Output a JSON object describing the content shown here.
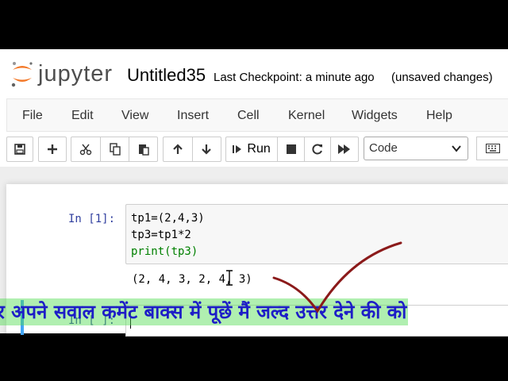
{
  "header": {
    "logo_text": "jupyter",
    "notebook_title": "Untitled35",
    "checkpoint": "Last Checkpoint: a minute ago",
    "status": "(unsaved changes)"
  },
  "menu": {
    "items": [
      {
        "label": "File"
      },
      {
        "label": "Edit"
      },
      {
        "label": "View"
      },
      {
        "label": "Insert"
      },
      {
        "label": "Cell"
      },
      {
        "label": "Kernel"
      },
      {
        "label": "Widgets"
      },
      {
        "label": "Help"
      }
    ]
  },
  "toolbar": {
    "run_label": "Run",
    "cell_type": "Code",
    "icons": [
      "save-icon",
      "plus-icon",
      "cut-icon",
      "copy-icon",
      "paste-icon",
      "arrow-up-icon",
      "arrow-down-icon",
      "step-forward-icon",
      "stop-icon",
      "restart-icon",
      "fast-forward-icon",
      "keyboard-icon"
    ]
  },
  "cells": [
    {
      "prompt": "In [1]:",
      "code": [
        "tp1=(2,4,3)",
        "tp3=tp1*2",
        "print(tp3)"
      ],
      "output": "(2, 4, 3, 2, 4, 3)"
    },
    {
      "prompt": "In [ ]:",
      "code": []
    }
  ],
  "overlay": {
    "caption": "र अपने सवाल कमेंट बाक्स में पूछें मैं जल्द उत्तर देने की को",
    "tick_color": "#8b1a1a",
    "highlight_color": "#50dc50",
    "caption_color": "#1d1dc7"
  }
}
